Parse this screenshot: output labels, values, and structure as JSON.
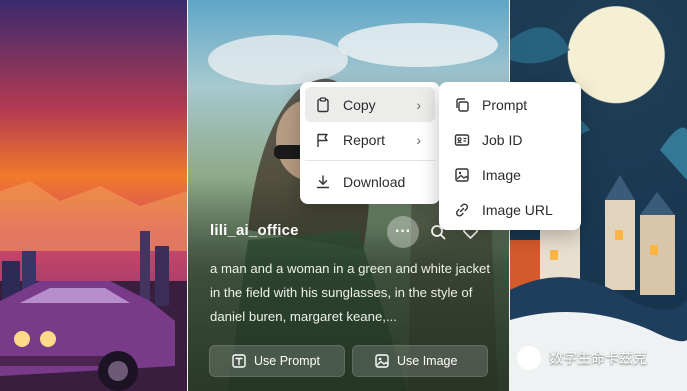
{
  "card": {
    "username": "lili_ai_office",
    "description": "a man and a woman in a green and white jacket in the field with his sunglasses, in the style of daniel buren, margaret keane,...",
    "more_label": "···",
    "use_prompt_label": "Use Prompt",
    "use_image_label": "Use Image"
  },
  "menu": {
    "items": [
      {
        "label": "Copy",
        "icon": "clipboard-icon",
        "has_submenu": true,
        "active": true
      },
      {
        "label": "Report",
        "icon": "flag-icon",
        "has_submenu": true
      },
      {
        "label": "Download",
        "icon": "download-icon",
        "has_submenu": false
      }
    ],
    "chevron": "›"
  },
  "submenu": {
    "items": [
      {
        "label": "Prompt",
        "icon": "copy-icon"
      },
      {
        "label": "Job ID",
        "icon": "id-card-icon"
      },
      {
        "label": "Image",
        "icon": "image-icon"
      },
      {
        "label": "Image URL",
        "icon": "link-icon"
      }
    ]
  },
  "watermark": {
    "text": "数字生命卡兹克"
  },
  "colors": {
    "menu_bg": "#ffffff",
    "menu_active": "#ececea",
    "text": "#2c2c2c"
  }
}
